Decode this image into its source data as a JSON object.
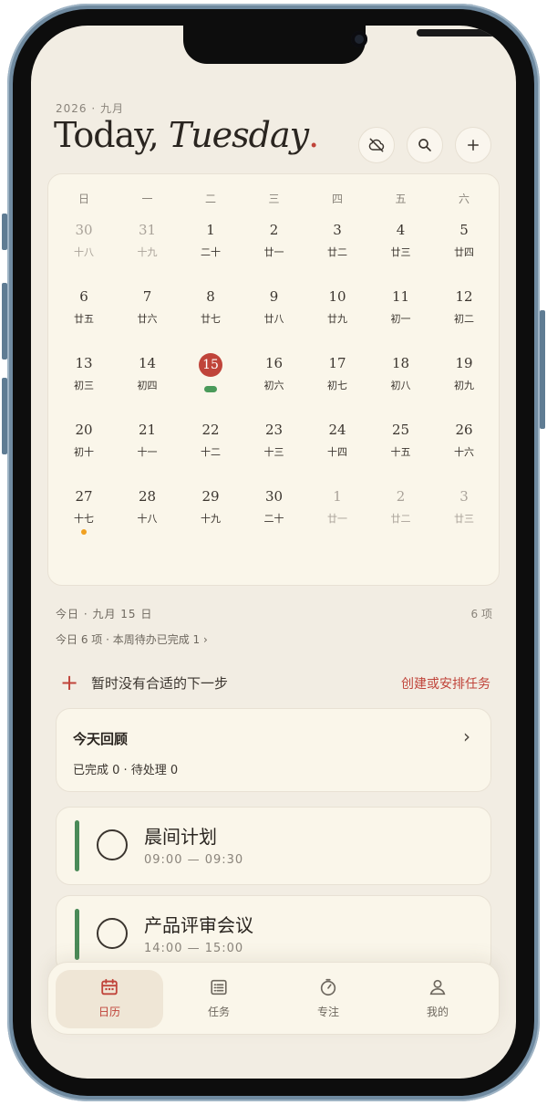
{
  "header": {
    "year_month": "2026 · 九月",
    "title_plain": "Today, ",
    "title_italic": "Tuesday",
    "title_dot": "."
  },
  "calendar": {
    "weekdays": [
      "日",
      "一",
      "二",
      "三",
      "四",
      "五",
      "六"
    ],
    "weeks": [
      [
        {
          "d": "30",
          "l": "十八",
          "dim": true
        },
        {
          "d": "31",
          "l": "十九",
          "dim": true
        },
        {
          "d": "1",
          "l": "二十"
        },
        {
          "d": "2",
          "l": "廿一"
        },
        {
          "d": "3",
          "l": "廿二"
        },
        {
          "d": "4",
          "l": "廿三"
        },
        {
          "d": "5",
          "l": "廿四"
        }
      ],
      [
        {
          "d": "6",
          "l": "廿五"
        },
        {
          "d": "7",
          "l": "廿六"
        },
        {
          "d": "8",
          "l": "廿七"
        },
        {
          "d": "9",
          "l": "廿八"
        },
        {
          "d": "10",
          "l": "廿九"
        },
        {
          "d": "11",
          "l": "初一"
        },
        {
          "d": "12",
          "l": "初二"
        }
      ],
      [
        {
          "d": "13",
          "l": "初三"
        },
        {
          "d": "14",
          "l": "初四"
        },
        {
          "d": "15",
          "l": "",
          "today": true,
          "events": "green"
        },
        {
          "d": "16",
          "l": "初六"
        },
        {
          "d": "17",
          "l": "初七"
        },
        {
          "d": "18",
          "l": "初八"
        },
        {
          "d": "19",
          "l": "初九"
        }
      ],
      [
        {
          "d": "20",
          "l": "初十"
        },
        {
          "d": "21",
          "l": "十一"
        },
        {
          "d": "22",
          "l": "十二"
        },
        {
          "d": "23",
          "l": "十三"
        },
        {
          "d": "24",
          "l": "十四"
        },
        {
          "d": "25",
          "l": "十五"
        },
        {
          "d": "26",
          "l": "十六"
        }
      ],
      [
        {
          "d": "27",
          "l": "十七",
          "events": "orange"
        },
        {
          "d": "28",
          "l": "十八"
        },
        {
          "d": "29",
          "l": "十九"
        },
        {
          "d": "30",
          "l": "二十"
        },
        {
          "d": "1",
          "l": "廿一",
          "dim": true
        },
        {
          "d": "2",
          "l": "廿二",
          "dim": true
        },
        {
          "d": "3",
          "l": "廿三",
          "dim": true
        }
      ]
    ]
  },
  "summary": {
    "date_line": "今日 · 九月 15 日",
    "count": "6 项",
    "sub": "今日 6 项 · 本周待办已完成 1  ›"
  },
  "next_step": {
    "plus": "+",
    "text": "暂时没有合适的下一步",
    "link": "创建或安排任务"
  },
  "review": {
    "title": "今天回顾",
    "chevron": "›",
    "stats": "已完成 0 · 待处理 0"
  },
  "tasks": [
    {
      "name": "晨间计划",
      "time": "09:00 — 09:30"
    },
    {
      "name": "产品评审会议",
      "time": "14:00 — 15:00"
    }
  ],
  "tabs": [
    {
      "label": "日历",
      "icon": "calendar-icon",
      "active": true
    },
    {
      "label": "任务",
      "icon": "list-icon"
    },
    {
      "label": "专注",
      "icon": "timer-icon"
    },
    {
      "label": "我的",
      "icon": "person-icon"
    }
  ],
  "colors": {
    "accent": "#c0443a",
    "background": "#f2ede3",
    "card": "#faf6ea",
    "task_bar": "#4a8a58",
    "event_green": "#4a9a5a",
    "event_orange": "#f0a020"
  }
}
